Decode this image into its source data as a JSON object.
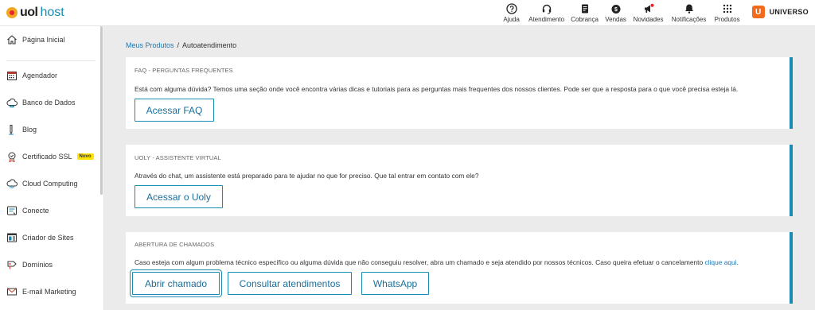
{
  "brand": {
    "uol": "uol",
    "host": "host"
  },
  "topnav": [
    {
      "label": "Ajuda",
      "icon": "help-circle-icon"
    },
    {
      "label": "Atendimento",
      "icon": "headset-icon"
    },
    {
      "label": "Cobrança",
      "icon": "invoice-icon"
    },
    {
      "label": "Vendas",
      "icon": "money-bag-icon"
    },
    {
      "label": "Novidades",
      "icon": "megaphone-icon"
    },
    {
      "label": "Notificações",
      "icon": "bell-icon"
    },
    {
      "label": "Produtos",
      "icon": "grid-icon"
    }
  ],
  "universo": {
    "badge": "U",
    "label": "UNIVERSO"
  },
  "sidebar": {
    "items": [
      {
        "label": "Página Inicial",
        "icon": "home-icon"
      },
      {
        "label": "Agendador",
        "icon": "calendar-icon"
      },
      {
        "label": "Banco de Dados",
        "icon": "database-cloud-icon"
      },
      {
        "label": "Blog",
        "icon": "pen-icon"
      },
      {
        "label": "Certificado SSL",
        "icon": "certificate-icon",
        "badge": "Novo"
      },
      {
        "label": "Cloud Computing",
        "icon": "cloud-icon"
      },
      {
        "label": "Conecte",
        "icon": "connect-icon"
      },
      {
        "label": "Criador de Sites",
        "icon": "site-builder-icon"
      },
      {
        "label": "Domínios",
        "icon": "domain-icon"
      },
      {
        "label": "E-mail Marketing",
        "icon": "email-icon"
      }
    ]
  },
  "breadcrumb": {
    "parent": "Meus Produtos",
    "separator": "/",
    "current": "Autoatendimento"
  },
  "cards": {
    "faq": {
      "title": "FAQ - PERGUNTAS FREQUENTES",
      "description": "Está com alguma dúvida? Temos uma seção onde você encontra várias dicas e tutoriais para as perguntas mais frequentes dos nossos clientes. Pode ser que a resposta para o que você precisa esteja lá.",
      "button": "Acessar FAQ"
    },
    "uoly": {
      "title": "UOLY - ASSISTENTE VIRTUAL",
      "description": "Através do chat, um assistente está preparado para te ajudar no que for preciso. Que tal entrar em contato com ele?",
      "button": "Acessar o Uoly"
    },
    "chamados": {
      "title": "ABERTURA DE CHAMADOS",
      "description": "Caso esteja com algum problema técnico específico ou alguma dúvida que não conseguiu resolver, abra um chamado e seja atendido por nossos técnicos. Caso queira efetuar o cancelamento ",
      "link": "clique aqui",
      "trailing": ".",
      "buttons": {
        "open": "Abrir chamado",
        "consult": "Consultar atendimentos",
        "whatsapp": "WhatsApp"
      }
    }
  },
  "colors": {
    "accent": "#1a8bb3",
    "link": "#1a78b8",
    "brand_orange": "#f26b1d",
    "novo_badge": "#ffe400"
  }
}
